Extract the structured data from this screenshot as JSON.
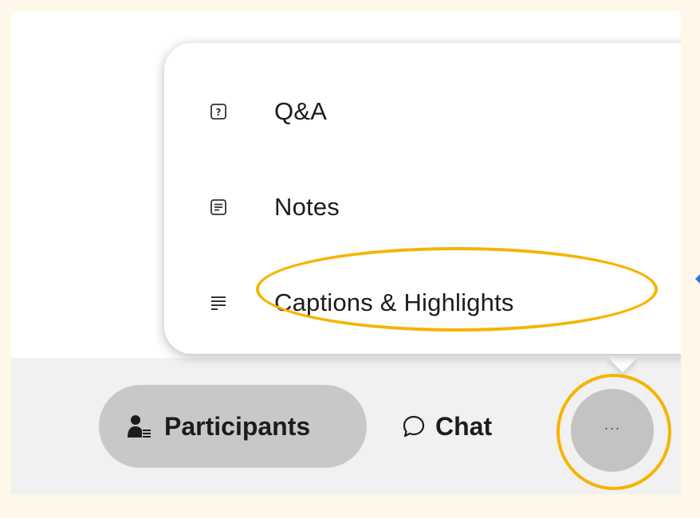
{
  "menu": {
    "items": [
      {
        "label": "Q&A",
        "icon": "question-box-icon"
      },
      {
        "label": "Notes",
        "icon": "note-icon"
      },
      {
        "label": "Captions & Highlights",
        "icon": "lines-icon"
      }
    ]
  },
  "toolbar": {
    "participants_label": "Participants",
    "participants_icon": "participants-icon",
    "chat_label": "Chat",
    "chat_icon": "chat-bubble-icon",
    "more_label": "···",
    "more_icon": "more-dots-icon"
  },
  "colors": {
    "highlight": "#f5b400",
    "active_button": "#c8c8c8",
    "outer_background": "#fdf8ea"
  }
}
